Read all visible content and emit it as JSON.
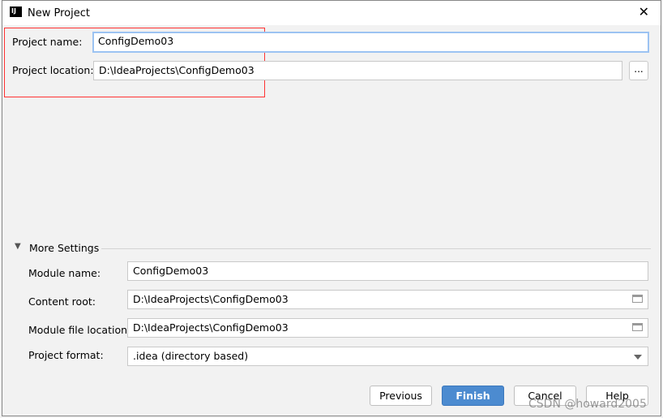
{
  "window": {
    "title": "New Project",
    "logo_text": "IJ"
  },
  "project": {
    "name_label": "Project name:",
    "name_value": "ConfigDemo03",
    "location_label": "Project location:",
    "location_value": "D:\\IdeaProjects\\ConfigDemo03",
    "browse_label": "..."
  },
  "more_settings": {
    "label": "More Settings",
    "expanded": true,
    "module_name_label": "Module name:",
    "module_name_value": "ConfigDemo03",
    "content_root_label": "Content root:",
    "content_root_value": "D:\\IdeaProjects\\ConfigDemo03",
    "module_file_label": "Module file location:",
    "module_file_value": "D:\\IdeaProjects\\ConfigDemo03",
    "format_label": "Project format:",
    "format_value": ".idea (directory based)"
  },
  "buttons": {
    "previous": "Previous",
    "finish": "Finish",
    "cancel": "Cancel",
    "help": "Help"
  },
  "watermark": "CSDN @howard2005",
  "colors": {
    "accent": "#4c8bd0",
    "highlight_box": "#ff3333"
  }
}
